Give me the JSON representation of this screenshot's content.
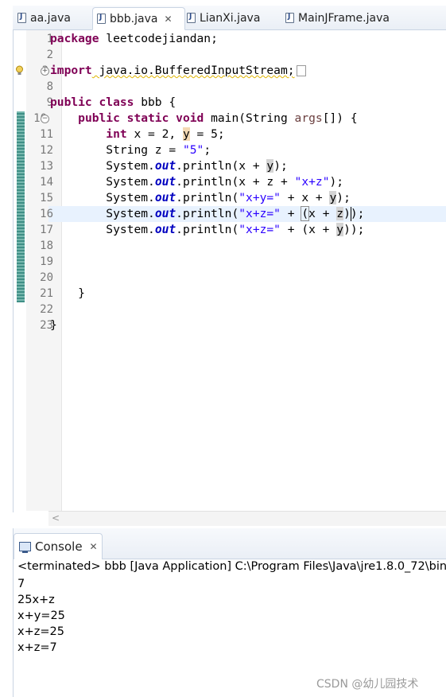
{
  "editor_tabs": [
    {
      "label": "aa.java"
    },
    {
      "label": "bbb.java",
      "close": "✕"
    },
    {
      "label": "LianXi.java"
    },
    {
      "label": "MainJFrame.java"
    }
  ],
  "line_numbers": [
    "1",
    "2",
    "3",
    "8",
    "9",
    "10",
    "11",
    "12",
    "13",
    "14",
    "15",
    "16",
    "17",
    "18",
    "19",
    "20",
    "21",
    "22",
    "23"
  ],
  "code": {
    "l1_kw": "package",
    "l1_rest": " leetcodejiandan;",
    "l3_kw": "import",
    "l3_rest": " java.io.BufferedInputStream;",
    "l9_kw": "public class",
    "l9_rest": " bbb {",
    "l10_kw": "public static void",
    "l10_rest": " main(String ",
    "l10_var": "args",
    "l10_end": "[]) {",
    "l11_kw": "int",
    "l11_a": " x = 2, ",
    "l11_y": "y",
    "l11_b": " = 5;",
    "l12_a": "String z = ",
    "l12_str": "\"5\"",
    "l12_b": ";",
    "l13_a": "System.",
    "l13_out": "out",
    "l13_b": ".println(x + ",
    "l13_y": "y",
    "l13_c": ");",
    "l14_a": "System.",
    "l14_out": "out",
    "l14_b": ".println(x + z + ",
    "l14_str": "\"x+z\"",
    "l14_c": ");",
    "l15_a": "System.",
    "l15_out": "out",
    "l15_b": ".println(",
    "l15_str": "\"x+y=\"",
    "l15_c": " + x + ",
    "l15_y": "y",
    "l15_d": ");",
    "l16_a": "System.",
    "l16_out": "out",
    "l16_b": ".println(",
    "l16_str": "\"x+z=\"",
    "l16_c": " + ",
    "l16_p": "(",
    "l16_d": "x + ",
    "l16_z": "z",
    "l16_e": "));",
    "l17_a": "System.",
    "l17_out": "out",
    "l17_b": ".println(",
    "l17_str": "\"x+z=\"",
    "l17_c": " + (x + ",
    "l17_y": "y",
    "l17_d": "));",
    "l21": "}",
    "l23": "}"
  },
  "console": {
    "tab_label": "Console",
    "tab_close": "✕",
    "header": "<terminated> bbb [Java Application] C:\\Program Files\\Java\\jre1.8.0_72\\bin",
    "output": [
      "7",
      "25x+z",
      "x+y=25",
      "x+z=25",
      "x+z=7"
    ]
  },
  "scroll_arrow": "<",
  "watermark": "CSDN @幼儿园技术"
}
